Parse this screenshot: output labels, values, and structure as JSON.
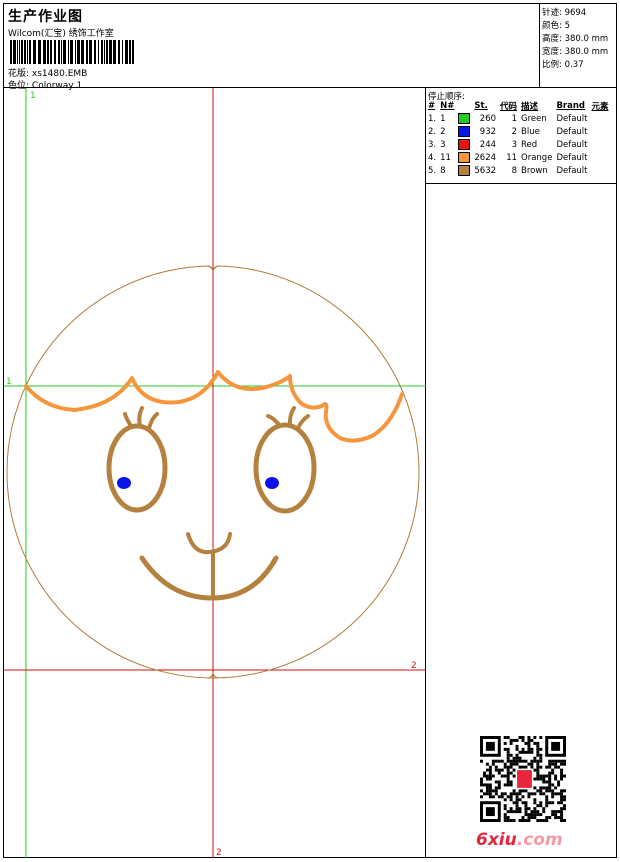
{
  "header": {
    "title": "生产作业图",
    "subtitle": "Wilcom(汇宝) 绣饰工作室",
    "design_label": "花版:",
    "design_value": "xs1480.EMB",
    "colorway_label": "色位:",
    "colorway_value": "Colorway 1"
  },
  "stats": [
    {
      "label": "针迹:",
      "value": "9694"
    },
    {
      "label": "颜色:",
      "value": "5"
    },
    {
      "label": "高度:",
      "value": "380.0 mm"
    },
    {
      "label": "宽度:",
      "value": "380.0 mm"
    },
    {
      "label": "比例:",
      "value": "0.37"
    }
  ],
  "stop_sequence": {
    "title": "停止顺序:",
    "columns": [
      "#",
      "N#",
      "St.",
      "代码",
      "描述",
      "Brand",
      "元素"
    ],
    "rows": [
      {
        "n": "1.",
        "nn": "1",
        "color": "#22cc22",
        "st": "260",
        "code": "1",
        "desc": "Green",
        "brand": "Default",
        "elem": ""
      },
      {
        "n": "2.",
        "nn": "2",
        "color": "#0a14e6",
        "st": "932",
        "code": "2",
        "desc": "Blue",
        "brand": "Default",
        "elem": ""
      },
      {
        "n": "3.",
        "nn": "3",
        "color": "#e81414",
        "st": "244",
        "code": "3",
        "desc": "Red",
        "brand": "Default",
        "elem": ""
      },
      {
        "n": "4.",
        "nn": "11",
        "color": "#f5963c",
        "st": "2624",
        "code": "11",
        "desc": "Orange",
        "brand": "Default",
        "elem": ""
      },
      {
        "n": "5.",
        "nn": "8",
        "color": "#b5813f",
        "st": "5632",
        "code": "8",
        "desc": "Brown",
        "brand": "Default",
        "elem": ""
      }
    ]
  },
  "guides": {
    "green_vertical_label": "1",
    "green_horizontal_label": "1",
    "red_horizontal_label": "2",
    "red_vertical_label": "2"
  },
  "watermark": {
    "logo_main": "6xiu",
    "logo_suffix": ".com"
  },
  "colors": {
    "outline": "#b07a3a",
    "hair": "#f5963c",
    "face": "#b5813f",
    "pupil": "#0a14e6",
    "guide_green": "#22cc22",
    "guide_red": "#cc1111"
  }
}
